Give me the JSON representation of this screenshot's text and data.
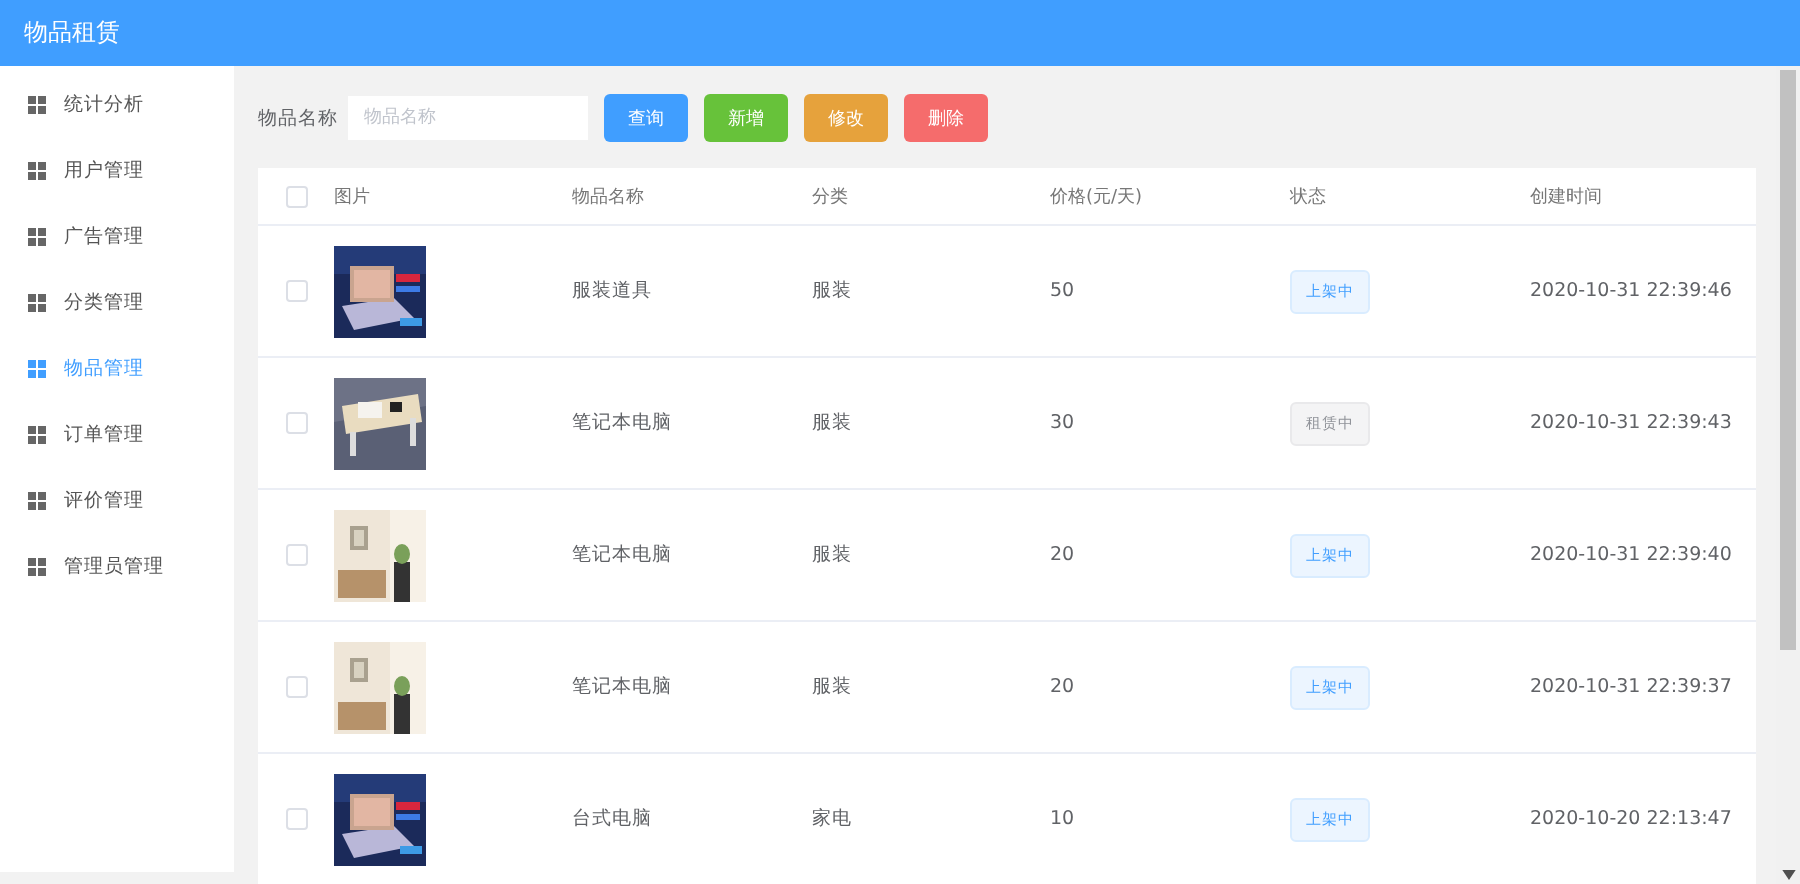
{
  "app": {
    "title": "物品租赁"
  },
  "sidebar": {
    "items": [
      {
        "label": "统计分析",
        "selected": false
      },
      {
        "label": "用户管理",
        "selected": false
      },
      {
        "label": "广告管理",
        "selected": false
      },
      {
        "label": "分类管理",
        "selected": false
      },
      {
        "label": "物品管理",
        "selected": true
      },
      {
        "label": "订单管理",
        "selected": false
      },
      {
        "label": "评价管理",
        "selected": false
      },
      {
        "label": "管理员管理",
        "selected": false
      }
    ]
  },
  "toolbar": {
    "label": "物品名称",
    "search": {
      "placeholder": "物品名称"
    },
    "buttons": [
      {
        "label": "查询",
        "kind": "primary"
      },
      {
        "label": "新增",
        "kind": "success"
      },
      {
        "label": "修改",
        "kind": "warning"
      },
      {
        "label": "删除",
        "kind": "danger"
      }
    ]
  },
  "table": {
    "columns": [
      "图片",
      "物品名称",
      "分类",
      "价格(元/天)",
      "状态",
      "创建时间"
    ],
    "all_checked": false,
    "rows": [
      {
        "checked": false,
        "name": "服装道具",
        "category": "服装",
        "price": "50",
        "status": {
          "label": "上架中",
          "kind": "listed"
        },
        "created": "2020-10-31 22:39:46"
      },
      {
        "checked": false,
        "name": "笔记本电脑",
        "category": "服装",
        "price": "30",
        "status": {
          "label": "租赁中",
          "kind": "rented"
        },
        "created": "2020-10-31 22:39:43"
      },
      {
        "checked": false,
        "name": "笔记本电脑",
        "category": "服装",
        "price": "20",
        "status": {
          "label": "上架中",
          "kind": "listed"
        },
        "created": "2020-10-31 22:39:40"
      },
      {
        "checked": false,
        "name": "笔记本电脑",
        "category": "服装",
        "price": "20",
        "status": {
          "label": "上架中",
          "kind": "listed"
        },
        "created": "2020-10-31 22:39:37"
      },
      {
        "checked": false,
        "name": "台式电脑",
        "category": "家电",
        "price": "10",
        "status": {
          "label": "上架中",
          "kind": "listed"
        },
        "created": "2020-10-20 22:13:47"
      }
    ]
  }
}
